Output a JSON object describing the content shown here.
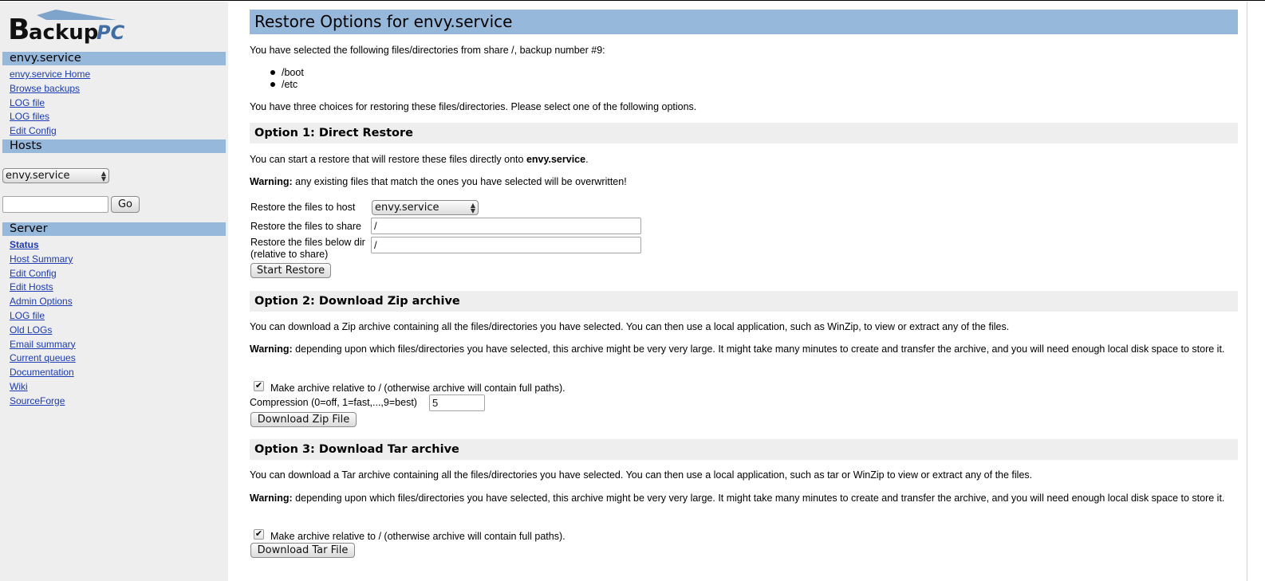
{
  "logo": {
    "text_main": "BackupPC"
  },
  "sidebar": {
    "host_section_title": "envy.service",
    "host_links": [
      "envy.service Home",
      "Browse backups",
      "LOG file",
      "LOG files",
      "Edit Config"
    ],
    "hosts_title": "Hosts",
    "host_select_value": "envy.service",
    "go_label": "Go",
    "server_title": "Server",
    "server_links": [
      "Status",
      "Host Summary",
      "Edit Config",
      "Edit Hosts",
      "Admin Options",
      "LOG file",
      "Old LOGs",
      "Email summary",
      "Current queues",
      "Documentation",
      "Wiki",
      "SourceForge"
    ]
  },
  "main": {
    "title": "Restore Options for envy.service",
    "intro": "You have selected the following files/directories from share /, backup number #9:",
    "files": [
      "/boot",
      "/etc"
    ],
    "choices_text": "You have three choices for restoring these files/directories. Please select one of the following options.",
    "warning_label": "Warning:",
    "option1": {
      "title": "Option 1: Direct Restore",
      "desc_prefix": "You can start a restore that will restore these files directly onto ",
      "desc_host": "envy.service",
      "desc_suffix": ".",
      "warning": " any existing files that match the ones you have selected will be overwritten!",
      "host_label": "Restore the files to host",
      "host_value": "envy.service",
      "share_label": "Restore the files to share",
      "share_value": "/",
      "dir_label_1": "Restore the files below dir",
      "dir_label_2": "(relative to share)",
      "dir_value": "/",
      "button": "Start Restore"
    },
    "option2": {
      "title": "Option 2: Download Zip archive",
      "desc": "You can download a Zip archive containing all the files/directories you have selected. You can then use a local application, such as WinZip, to view or extract any of the files.",
      "warning": " depending upon which files/directories you have selected, this archive might be very very large. It might take many minutes to create and transfer the archive, and you will need enough local disk space to store it.",
      "checkbox_label": "Make archive relative to / (otherwise archive will contain full paths).",
      "compression_label": "Compression (0=off, 1=fast,...,9=best)",
      "compression_value": "5",
      "button": "Download Zip File"
    },
    "option3": {
      "title": "Option 3: Download Tar archive",
      "desc": "You can download a Tar archive containing all the files/directories you have selected. You can then use a local application, such as tar or WinZip to view or extract any of the files.",
      "warning": " depending upon which files/directories you have selected, this archive might be very very large. It might take many minutes to create and transfer the archive, and you will need enough local disk space to store it.",
      "checkbox_label": "Make archive relative to / (otherwise archive will contain full paths).",
      "button": "Download Tar File"
    }
  }
}
